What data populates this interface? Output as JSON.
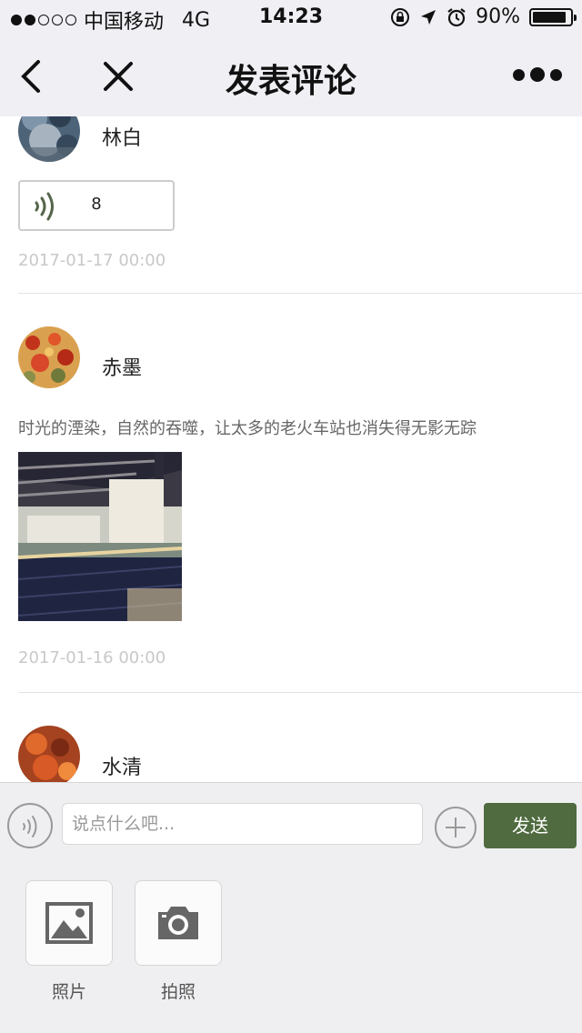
{
  "status_bar": {
    "carrier": "中国移动",
    "network": "4G",
    "time": "14:23",
    "battery_percent": "90%",
    "battery_level": 0.9,
    "signal_bars_filled": 2,
    "signal_bars_total": 5
  },
  "nav": {
    "title": "发表评论",
    "icons": [
      "back-icon",
      "close-icon",
      "more-icon"
    ]
  },
  "comments": [
    {
      "username": "林白",
      "voice_length": "8",
      "time": "2017-01-17 00:00"
    },
    {
      "username": "赤墨",
      "text": "时光的湮染，自然的吞噬，让太多的老火车站也消失得无影无踪",
      "time": "2017-01-16 00:00"
    },
    {
      "username": "水清"
    }
  ],
  "input_bar": {
    "placeholder": "说点什么吧...",
    "value": "",
    "send_label": "发送"
  },
  "tools": [
    {
      "label": "照片",
      "icon": "image-icon"
    },
    {
      "label": "拍照",
      "icon": "camera-icon"
    }
  ],
  "colors": {
    "accent": "#4f6b3f",
    "bar_bg": "#efeff4",
    "timestamp": "#c8c8c8"
  }
}
